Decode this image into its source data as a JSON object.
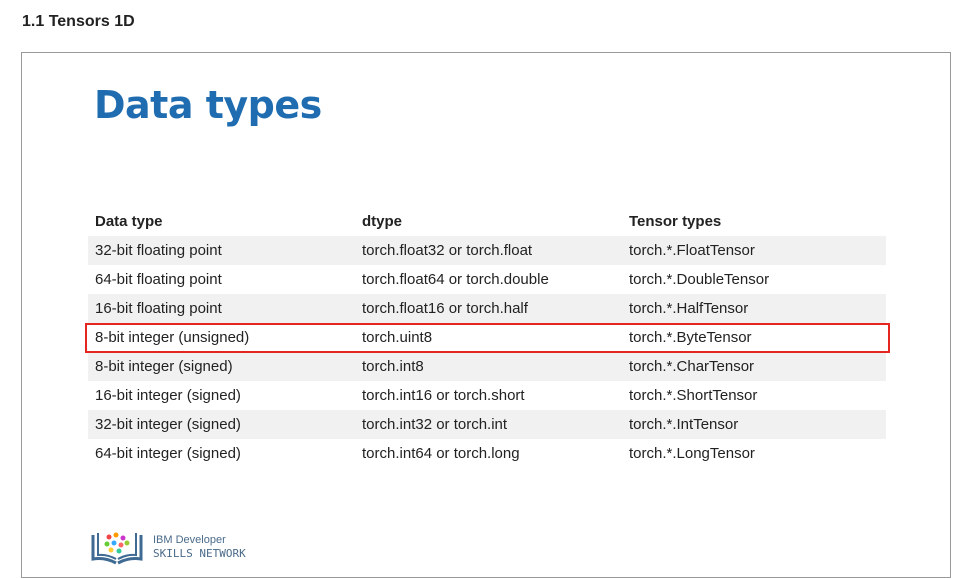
{
  "section_title": "1.1 Tensors 1D",
  "slide": {
    "title": "Data types",
    "table": {
      "headers": [
        "Data type",
        "dtype",
        "Tensor types"
      ],
      "rows": [
        [
          "32-bit floating point",
          "torch.float32 or torch.float",
          "torch.*.FloatTensor"
        ],
        [
          "64-bit floating point",
          "torch.float64 or torch.double",
          "torch.*.DoubleTensor"
        ],
        [
          "16-bit floating point",
          "torch.float16 or torch.half",
          "torch.*.HalfTensor"
        ],
        [
          "8-bit integer (unsigned)",
          "torch.uint8",
          "torch.*.ByteTensor"
        ],
        [
          "8-bit integer (signed)",
          "torch.int8",
          "torch.*.CharTensor"
        ],
        [
          "16-bit integer (signed)",
          "torch.int16 or torch.short",
          "torch.*.ShortTensor"
        ],
        [
          "32-bit integer (signed)",
          "torch.int32 or torch.int",
          "torch.*.IntTensor"
        ],
        [
          "64-bit integer (signed)",
          "torch.int64 or torch.long",
          "torch.*.LongTensor"
        ]
      ],
      "highlighted_row": 3,
      "highlight_color": "#e52520"
    },
    "logo": {
      "line1": "IBM Developer",
      "line2": "SKILLS NETWORK"
    },
    "title_color": "#1f6db0"
  }
}
